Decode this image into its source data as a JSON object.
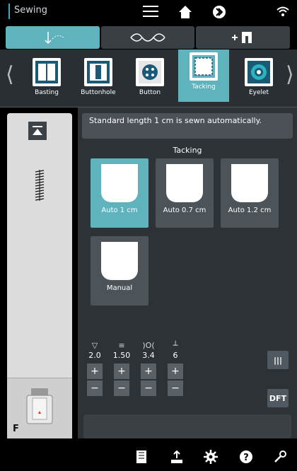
{
  "topbar": {
    "title": "Sewing",
    "menu_icon": "menu-icon",
    "home_icon": "home-icon",
    "forward_icon": "forward-icon",
    "wifi_icon": "wifi-icon"
  },
  "modes": [
    {
      "label": "stitch-mode",
      "active": true
    },
    {
      "label": "embroidery-mode",
      "active": false
    },
    {
      "label": "add-mode",
      "active": false
    }
  ],
  "stitches": [
    {
      "label": "Basting"
    },
    {
      "label": "Buttonhole"
    },
    {
      "label": "Button"
    },
    {
      "label": "Tacking",
      "active": true
    },
    {
      "label": "Eyelet"
    }
  ],
  "info": {
    "text": "Standard length 1 cm is sewn automatically."
  },
  "section": {
    "title": "Tacking"
  },
  "cards": [
    {
      "label": "Auto 1 cm",
      "active": true
    },
    {
      "label": "Auto 0.7 cm"
    },
    {
      "label": "Auto 1.2 cm"
    },
    {
      "label": "Manual"
    }
  ],
  "settings": [
    {
      "icon": "tension",
      "value": "2.0"
    },
    {
      "icon": "stitch-length",
      "value": "1.50"
    },
    {
      "icon": "stitch-width",
      "value": "3.4"
    },
    {
      "icon": "presser-foot",
      "value": "6"
    }
  ],
  "right_buttons": {
    "ruler_label": "|||",
    "dft_label": "DFT"
  },
  "side": {
    "foot_letter": "F"
  },
  "colors": {
    "accent": "#5fb3bd",
    "panel": "#2c3236"
  }
}
